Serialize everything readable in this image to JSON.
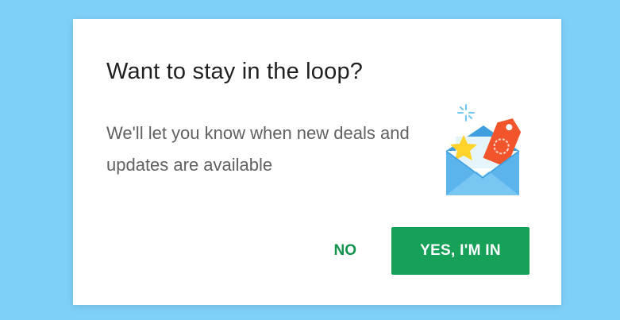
{
  "dialog": {
    "title": "Want to stay in the loop?",
    "message": "We'll let you know when new deals and updates are available",
    "illustration": "envelope-with-star-and-tag-icon",
    "no_label": "NO",
    "yes_label": "YES, I'M IN"
  },
  "colors": {
    "background": "#7fd0f9",
    "dialog": "#ffffff",
    "accent_green": "#17a058",
    "title_text": "#212121",
    "body_text": "#616161",
    "envelope_blue": "#5bb4ec",
    "star_yellow": "#ffd32a",
    "tag_red": "#f2552c"
  }
}
